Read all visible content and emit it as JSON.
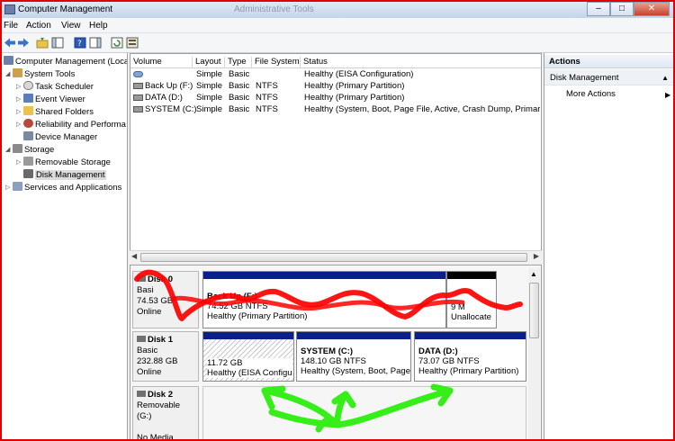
{
  "window": {
    "title": "Computer Management",
    "title_faded": "Administrative Tools",
    "buttons": {
      "minimize": "–",
      "maximize": "□",
      "close": "✕"
    }
  },
  "menu": [
    "File",
    "Action",
    "View",
    "Help"
  ],
  "tree": [
    {
      "label": "Computer Management (Local",
      "level": 0,
      "icon": "computer-icon",
      "expander": ""
    },
    {
      "label": "System Tools",
      "level": 1,
      "icon": "tools-icon",
      "expander": "◢"
    },
    {
      "label": "Task Scheduler",
      "level": 2,
      "icon": "clock-icon",
      "expander": "▷"
    },
    {
      "label": "Event Viewer",
      "level": 2,
      "icon": "event-viewer-icon",
      "expander": "▷"
    },
    {
      "label": "Shared Folders",
      "level": 2,
      "icon": "folder-icon",
      "expander": "▷"
    },
    {
      "label": "Reliability and Performa",
      "level": 2,
      "icon": "performance-icon",
      "expander": "▷"
    },
    {
      "label": "Device Manager",
      "level": 2,
      "icon": "device-manager-icon",
      "expander": ""
    },
    {
      "label": "Storage",
      "level": 1,
      "icon": "storage-icon",
      "expander": "◢"
    },
    {
      "label": "Removable Storage",
      "level": 2,
      "icon": "removable-storage-icon",
      "expander": "▷"
    },
    {
      "label": "Disk Management",
      "level": 2,
      "icon": "disk-icon",
      "expander": "",
      "selected": true
    },
    {
      "label": "Services and Applications",
      "level": 1,
      "icon": "services-icon",
      "expander": "▷"
    }
  ],
  "volumes": {
    "headers": [
      "Volume",
      "Layout",
      "Type",
      "File System",
      "Status"
    ],
    "rows": [
      {
        "volume": "",
        "layout": "Simple",
        "type": "Basic",
        "fs": "",
        "status": "Healthy (EISA Configuration)"
      },
      {
        "volume": "Back Up (F:)",
        "layout": "Simple",
        "type": "Basic",
        "fs": "NTFS",
        "status": "Healthy (Primary Partition)"
      },
      {
        "volume": "DATA (D:)",
        "layout": "Simple",
        "type": "Basic",
        "fs": "NTFS",
        "status": "Healthy (Primary Partition)"
      },
      {
        "volume": "SYSTEM (C:)",
        "layout": "Simple",
        "type": "Basic",
        "fs": "NTFS",
        "status": "Healthy (System, Boot, Page File, Active, Crash Dump, Primary Pa"
      }
    ]
  },
  "disks": [
    {
      "name": "Disk 0",
      "type": "Basi",
      "size": "74.53 GB",
      "state": "Online",
      "partitions": [
        {
          "title": "Back Up (F:)",
          "size": "74.52 GB NTFS",
          "status": "Healthy (Primary Partition)"
        },
        {
          "title": "",
          "size": "9 M",
          "status": "Unallocate"
        }
      ]
    },
    {
      "name": "Disk 1",
      "type": "Basic",
      "size": "232.88 GB",
      "state": "Online",
      "partitions": [
        {
          "title": "",
          "size": "11.72 GB",
          "status": "Healthy (EISA Configu"
        },
        {
          "title": "SYSTEM  (C:)",
          "size": "148.10 GB NTFS",
          "status": "Healthy (System, Boot, Page F"
        },
        {
          "title": "DATA  (D:)",
          "size": "73.07 GB NTFS",
          "status": "Healthy (Primary Partition)"
        }
      ]
    },
    {
      "name": "Disk 2",
      "type": "Removable (G:)",
      "size": "",
      "state": "No Media",
      "partitions": []
    }
  ],
  "actions": {
    "header": "Actions",
    "section": "Disk Management",
    "items": [
      "More Actions"
    ]
  },
  "colors": {
    "primary_partition": "#0a1e8c",
    "unallocated": "#000000",
    "annotation_red": "#ff0000",
    "annotation_green": "#22ee00"
  }
}
